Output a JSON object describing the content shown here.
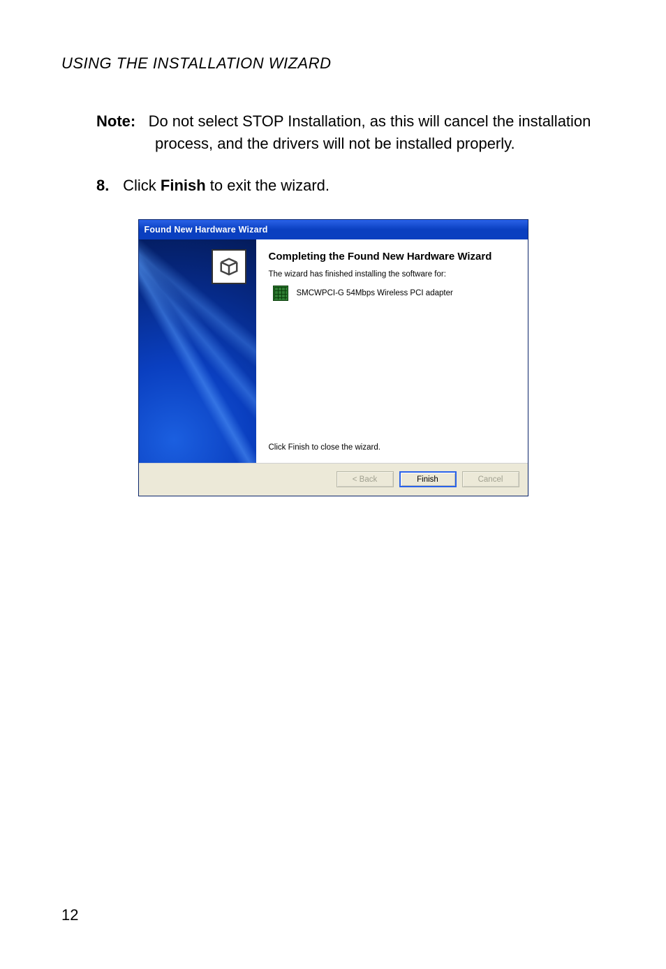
{
  "running_head": "USING THE INSTALLATION WIZARD",
  "note": {
    "label": "Note:",
    "text": "Do not select STOP Installation, as this will cancel the installation process, and the drivers will not be installed properly."
  },
  "step": {
    "number": "8.",
    "prefix": "Click ",
    "bold": "Finish",
    "suffix": " to exit the wizard."
  },
  "dialog": {
    "title": "Found New Hardware Wizard",
    "heading": "Completing the Found New Hardware Wizard",
    "subtext": "The wizard has finished installing the software for:",
    "device": "SMCWPCI-G 54Mbps Wireless PCI adapter",
    "close_hint": "Click Finish to close the wizard.",
    "buttons": {
      "back": "< Back",
      "finish": "Finish",
      "cancel": "Cancel"
    }
  },
  "page_number": "12"
}
